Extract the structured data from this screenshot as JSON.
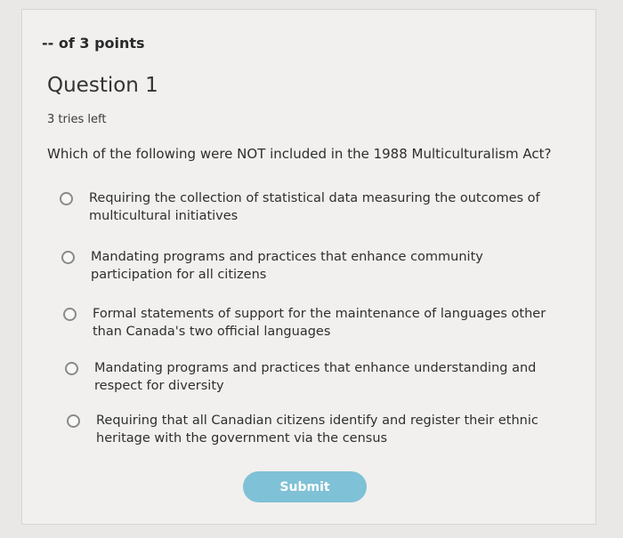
{
  "header": {
    "points": "-- of 3 points"
  },
  "question": {
    "title": "Question 1",
    "tries": "3 tries left",
    "prompt": "Which of the following were NOT included in the 1988 Multiculturalism Act?"
  },
  "options": [
    {
      "label": "Requiring the collection of statistical data measuring the outcomes of multicultural initiatives",
      "selected": false
    },
    {
      "label": "Mandating programs and practices that enhance community participation for all citizens",
      "selected": false
    },
    {
      "label": "Formal statements of support for the maintenance of languages other than Canada's two official languages",
      "selected": false
    },
    {
      "label": "Mandating programs and practices that enhance understanding and respect for diversity",
      "selected": false
    },
    {
      "label": "Requiring that all Canadian citizens identify and register their ethnic heritage with the government via the census",
      "selected": false
    }
  ],
  "actions": {
    "submit_label": "Submit"
  },
  "colors": {
    "submit_button": "#7fc1d6",
    "card_background": "#f1f0ee"
  }
}
